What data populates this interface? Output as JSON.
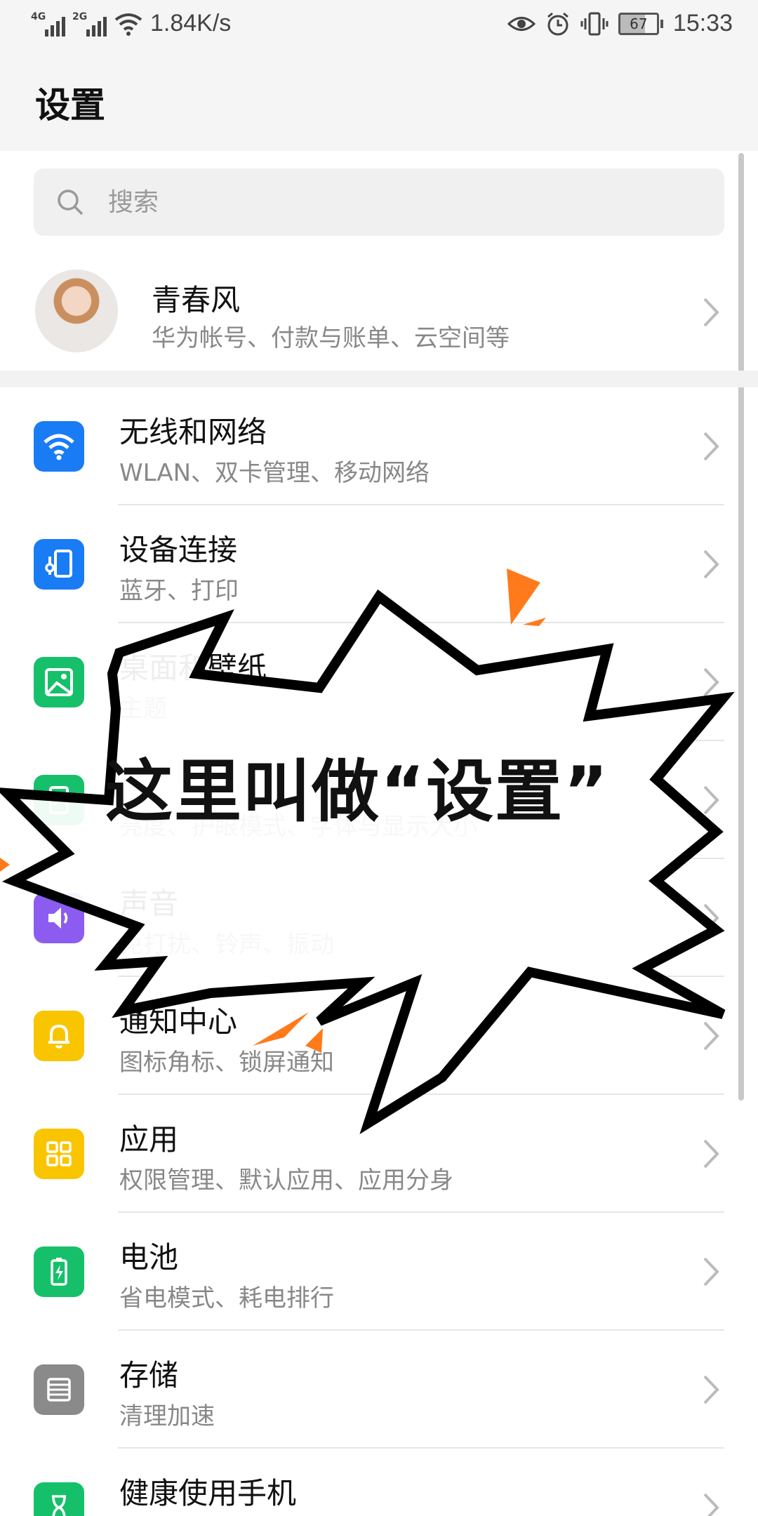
{
  "status_bar": {
    "network1": "4G",
    "network2": "2G",
    "speed": "1.84K/s",
    "battery": "67",
    "time": "15:33"
  },
  "header": {
    "title": "设置"
  },
  "search": {
    "placeholder": "搜索"
  },
  "profile": {
    "name": "青春风",
    "subtitle": "华为帐号、付款与账单、云空间等"
  },
  "settings_items": [
    {
      "title": "无线和网络",
      "subtitle": "WLAN、双卡管理、移动网络",
      "icon": "wifi-icon",
      "color": "#1a7cf5"
    },
    {
      "title": "设备连接",
      "subtitle": "蓝牙、打印",
      "icon": "device-connection-icon",
      "color": "#1a7cf5"
    },
    {
      "title": "桌面和壁纸",
      "subtitle": "主题",
      "icon": "wallpaper-icon",
      "color": "#16c06a"
    },
    {
      "title": "",
      "subtitle": "亮度、护眼模式、字体与显示大小",
      "icon": "display-icon",
      "color": "#16c06a"
    },
    {
      "title": "声音",
      "subtitle": "免打扰、铃声、振动",
      "icon": "sound-icon",
      "color": "#8c5cf0"
    },
    {
      "title": "通知中心",
      "subtitle": "图标角标、锁屏通知",
      "icon": "bell-icon",
      "color": "#f9c500"
    },
    {
      "title": "应用",
      "subtitle": "权限管理、默认应用、应用分身",
      "icon": "apps-grid-icon",
      "color": "#f9c500"
    },
    {
      "title": "电池",
      "subtitle": "省电模式、耗电排行",
      "icon": "battery-icon",
      "color": "#16c06a"
    },
    {
      "title": "存储",
      "subtitle": "清理加速",
      "icon": "storage-icon",
      "color": "#8a8a8a"
    },
    {
      "title": "健康使用手机",
      "subtitle": "",
      "icon": "hourglass-icon",
      "color": "#16c06a"
    }
  ],
  "overlay": {
    "caption": "这里叫做“设置”",
    "burst_color": "#000000",
    "accent_color": "#ff7a1a"
  }
}
